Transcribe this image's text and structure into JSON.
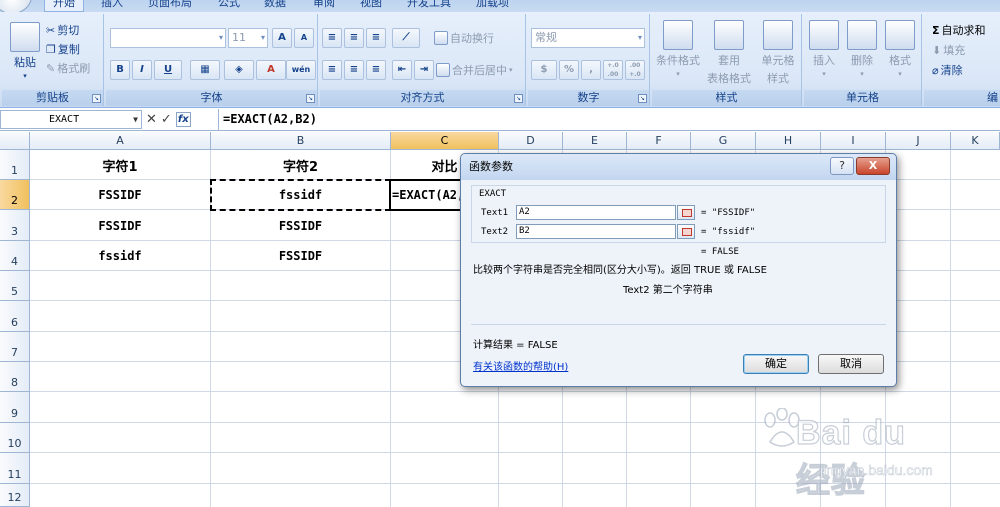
{
  "tabs": [
    "开始",
    "插入",
    "页面布局",
    "公式",
    "数据",
    "审阅",
    "视图",
    "开发工具",
    "加载项"
  ],
  "ribbon": {
    "clipboard": {
      "label": "剪贴板",
      "paste": "粘贴",
      "cut": "剪切",
      "copy": "复制",
      "format_painter": "格式刷"
    },
    "font": {
      "label": "字体",
      "size": "11",
      "bold": "B",
      "italic": "I",
      "underline": "U",
      "grow": "A",
      "shrink": "A",
      "font_color": "A",
      "phonetic": "wén"
    },
    "alignment": {
      "label": "对齐方式",
      "wrap": "自动换行",
      "merge": "合并后居中"
    },
    "number": {
      "label": "数字",
      "format": "常规",
      "percent": "%",
      "comma": ",",
      "inc_decimal": "+.0 .00",
      "dec_decimal": ".00 +.0"
    },
    "styles": {
      "label": "样式",
      "conditional": "条件格式",
      "table": "套用",
      "table2": "表格格式",
      "cell": "单元格",
      "cell2": "样式"
    },
    "cells": {
      "label": "单元格",
      "insert": "插入",
      "delete": "删除",
      "format": "格式"
    },
    "editing": {
      "label": "编",
      "autosum": "自动求和",
      "fill": "填充",
      "clear": "清除",
      "sigma": "Σ"
    }
  },
  "formula_bar": {
    "name_box": "EXACT",
    "cancel": "✕",
    "enter": "✓",
    "fx": "fx",
    "formula": "=EXACT(A2,B2)"
  },
  "columns": [
    "A",
    "B",
    "C",
    "D",
    "E",
    "F",
    "G",
    "H",
    "I",
    "J",
    "K"
  ],
  "rows": [
    "1",
    "2",
    "3",
    "4",
    "5",
    "6",
    "7",
    "8",
    "9",
    "10",
    "11",
    "12"
  ],
  "cells": {
    "A1": "字符1",
    "B1": "字符2",
    "C1": "对比",
    "A2": "FSSIDF",
    "B2": "fssidf",
    "C2": "=EXACT(A2,B2)",
    "A3": "FSSIDF",
    "B3": "FSSIDF",
    "A4": "fssidf",
    "B4": "FSSIDF"
  },
  "dialog": {
    "title": "函数参数",
    "help_button": "?",
    "close_button": "X",
    "function_name": "EXACT",
    "args": [
      {
        "label": "Text1",
        "value": "A2",
        "result": "= \"FSSIDF\""
      },
      {
        "label": "Text2",
        "value": "B2",
        "result": "= \"fssidf\""
      }
    ],
    "formula_result": "= FALSE",
    "description": "比较两个字符串是否完全相同(区分大小写)。返回 TRUE 或 FALSE",
    "arg_description": "Text2  第二个字符串",
    "calc_result": "计算结果 =  FALSE",
    "help_link": "有关该函数的帮助(H)",
    "ok": "确定",
    "cancel": "取消"
  },
  "watermark": {
    "main": "Bai du 经验",
    "sub": "jingyan.baidu.com"
  }
}
